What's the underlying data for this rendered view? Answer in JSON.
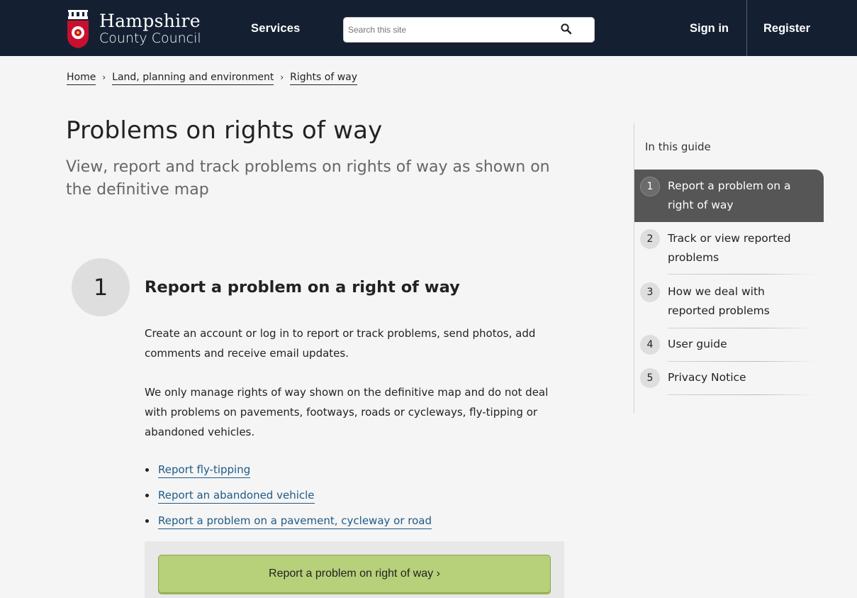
{
  "header": {
    "logo_line1": "Hampshire",
    "logo_line2": "County Council",
    "services_label": "Services",
    "search_placeholder": "Search this site",
    "signin_label": "Sign in",
    "register_label": "Register"
  },
  "breadcrumb": {
    "items": [
      "Home",
      "Land, planning and environment",
      "Rights of way"
    ],
    "separator": "›"
  },
  "page": {
    "title": "Problems on rights of way",
    "subtitle": "View, report and track problems on rights of way as shown on the definitive map"
  },
  "step": {
    "number": "1",
    "heading": "Report a problem on a right of way",
    "para1": "Create an account or log in to report or track problems, send photos, add comments and receive email updates.",
    "para2": "We only manage rights of way shown on the definitive map and do not deal with problems on pavements, footways, roads or cycleways, fly-tipping or abandoned vehicles.",
    "links": [
      "Report fly-tipping",
      "Report an abandoned vehicle",
      "Report a problem on a pavement, cycleway or road"
    ],
    "cta_label": "Report a problem on right of way ›"
  },
  "guide": {
    "title": "In this guide",
    "items": [
      {
        "num": "1",
        "label": "Report a problem on a right of way"
      },
      {
        "num": "2",
        "label": "Track or view reported problems"
      },
      {
        "num": "3",
        "label": "How we deal with reported problems"
      },
      {
        "num": "4",
        "label": "User guide"
      },
      {
        "num": "5",
        "label": "Privacy Notice"
      }
    ]
  },
  "colors": {
    "header_bg": "#142032",
    "link": "#1e5b8a",
    "cta_bg": "#b7d07a",
    "guide_active_bg": "#565656"
  },
  "icons": {
    "search": "search-icon",
    "crest": "crest-icon",
    "breadcrumb_sep": "chevron-right-icon"
  }
}
